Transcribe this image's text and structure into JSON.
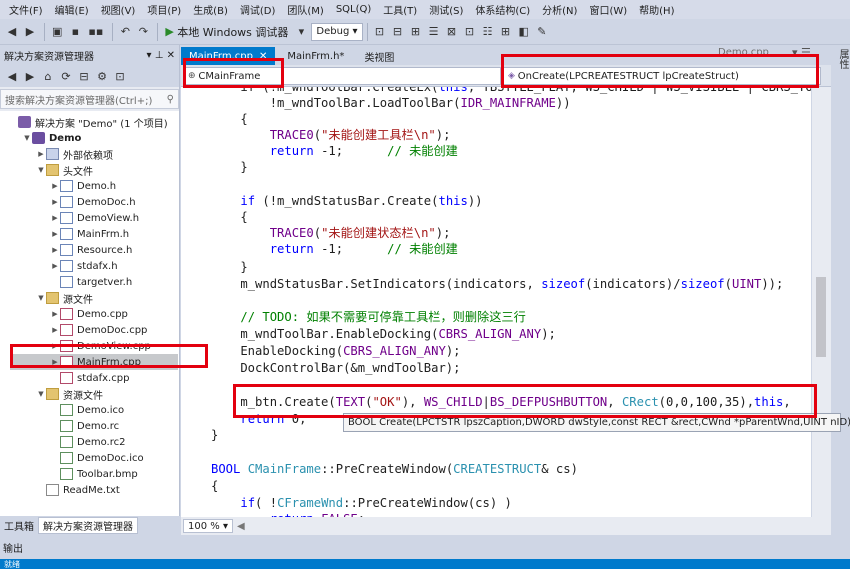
{
  "menu": [
    "文件(F)",
    "编辑(E)",
    "视图(V)",
    "项目(P)",
    "生成(B)",
    "调试(D)",
    "团队(M)",
    "SQL(Q)",
    "工具(T)",
    "测试(S)",
    "体系结构(C)",
    "分析(N)",
    "窗口(W)",
    "帮助(H)"
  ],
  "toolbar": {
    "run_label": "本地 Windows 调试器",
    "config": "Debug"
  },
  "explorer": {
    "title": "解决方案资源管理器",
    "search_placeholder": "搜索解决方案资源管理器(Ctrl+;)",
    "tree": [
      {
        "label": "解决方案 \"Demo\" (1 个项目)",
        "indent": 0,
        "icon": "sln",
        "exp": ""
      },
      {
        "label": "Demo",
        "indent": 1,
        "icon": "proj",
        "exp": "▼",
        "bold": true
      },
      {
        "label": "外部依赖项",
        "indent": 2,
        "icon": "dep",
        "exp": "▶"
      },
      {
        "label": "头文件",
        "indent": 2,
        "icon": "fold",
        "exp": "▼"
      },
      {
        "label": "Demo.h",
        "indent": 3,
        "icon": "h",
        "exp": "▶"
      },
      {
        "label": "DemoDoc.h",
        "indent": 3,
        "icon": "h",
        "exp": "▶"
      },
      {
        "label": "DemoView.h",
        "indent": 3,
        "icon": "h",
        "exp": "▶"
      },
      {
        "label": "MainFrm.h",
        "indent": 3,
        "icon": "h",
        "exp": "▶"
      },
      {
        "label": "Resource.h",
        "indent": 3,
        "icon": "h",
        "exp": "▶"
      },
      {
        "label": "stdafx.h",
        "indent": 3,
        "icon": "h",
        "exp": "▶"
      },
      {
        "label": "targetver.h",
        "indent": 3,
        "icon": "h",
        "exp": ""
      },
      {
        "label": "源文件",
        "indent": 2,
        "icon": "fold",
        "exp": "▼"
      },
      {
        "label": "Demo.cpp",
        "indent": 3,
        "icon": "cpp",
        "exp": "▶"
      },
      {
        "label": "DemoDoc.cpp",
        "indent": 3,
        "icon": "cpp",
        "exp": "▶"
      },
      {
        "label": "DemoView.cpp",
        "indent": 3,
        "icon": "cpp",
        "exp": "▶"
      },
      {
        "label": "MainFrm.cpp",
        "indent": 3,
        "icon": "cpp",
        "exp": "▶",
        "sel": true
      },
      {
        "label": "stdafx.cpp",
        "indent": 3,
        "icon": "cpp",
        "exp": ""
      },
      {
        "label": "资源文件",
        "indent": 2,
        "icon": "fold",
        "exp": "▼"
      },
      {
        "label": "Demo.ico",
        "indent": 3,
        "icon": "res",
        "exp": ""
      },
      {
        "label": "Demo.rc",
        "indent": 3,
        "icon": "res",
        "exp": ""
      },
      {
        "label": "Demo.rc2",
        "indent": 3,
        "icon": "res",
        "exp": ""
      },
      {
        "label": "DemoDoc.ico",
        "indent": 3,
        "icon": "res",
        "exp": ""
      },
      {
        "label": "Toolbar.bmp",
        "indent": 3,
        "icon": "res",
        "exp": ""
      },
      {
        "label": "ReadMe.txt",
        "indent": 2,
        "icon": "txt",
        "exp": ""
      }
    ],
    "tab_toolbox": "工具箱",
    "tab_explorer": "解决方案资源管理器"
  },
  "editor": {
    "tabs": [
      {
        "label": "MainFrm.cpp",
        "active": true
      },
      {
        "label": "MainFrm.h*",
        "active": false
      },
      {
        "label": "类视图",
        "active": false
      }
    ],
    "right_tab": "Demo.cpp",
    "class_combo": "CMainFrame",
    "method_combo": "OnCreate(LPCREATESTRUCT lpCreateStruct)",
    "zoom": "100 %",
    "tooltip": "BOOL Create(LPCTSTR lpszCaption,DWORD dwStyle,const RECT &rect,CWnd *pParentWnd,UINT nID)"
  },
  "right_panel": "属性",
  "output_label": "输出",
  "status": "就绪"
}
